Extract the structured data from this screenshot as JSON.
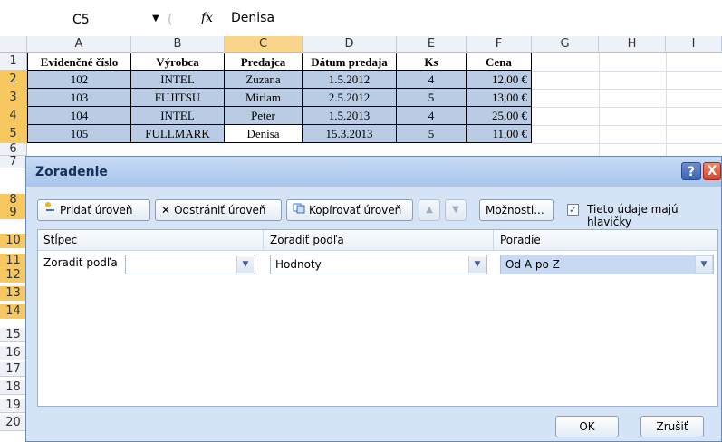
{
  "formula_bar": {
    "name_box": "C5",
    "fx_label": "fx",
    "value": "Denisa"
  },
  "columns": [
    "A",
    "B",
    "C",
    "D",
    "E",
    "F",
    "G",
    "H",
    "I"
  ],
  "rows": [
    "1",
    "2",
    "3",
    "4",
    "5",
    "6",
    "7",
    "8",
    "9",
    "10",
    "11",
    "12",
    "13",
    "14",
    "15",
    "16",
    "17",
    "18",
    "19",
    "20"
  ],
  "table": {
    "headers": [
      "Evidenčné číslo",
      "Výrobca",
      "Predajca",
      "Dátum predaja",
      "Ks",
      "Cena"
    ],
    "rows": [
      [
        "102",
        "INTEL",
        "Zuzana",
        "1.5.2012",
        "4",
        "12,00 €"
      ],
      [
        "103",
        "FUJITSU",
        "Miriam",
        "2.5.2012",
        "5",
        "13,00 €"
      ],
      [
        "104",
        "INTEL",
        "Peter",
        "1.5.2013",
        "4",
        "25,00 €"
      ],
      [
        "105",
        "FULLMARK",
        "Denisa",
        "15.3.2013",
        "5",
        "11,00 €"
      ]
    ]
  },
  "dialog": {
    "title": "Zoradenie",
    "help": "?",
    "close": "X",
    "toolbar": {
      "add_level": "Pridať úroveň",
      "delete_level": "Odstrániť úroveň",
      "copy_level": "Kopírovať úroveň",
      "move_up": "▲",
      "move_down": "▼",
      "options": "Možnosti...",
      "headers_checkbox": "Tieto údaje majú hlavičky",
      "headers_checked": true
    },
    "panel_headers": {
      "column": "Stĺpec",
      "sort_on": "Zoradiť podľa",
      "order": "Poradie"
    },
    "level": {
      "label": "Zoradiť podľa",
      "column_value": "",
      "sort_on_value": "Hodnoty",
      "order_value": "Od A po Z"
    },
    "ok": "OK",
    "cancel": "Zrušiť"
  }
}
